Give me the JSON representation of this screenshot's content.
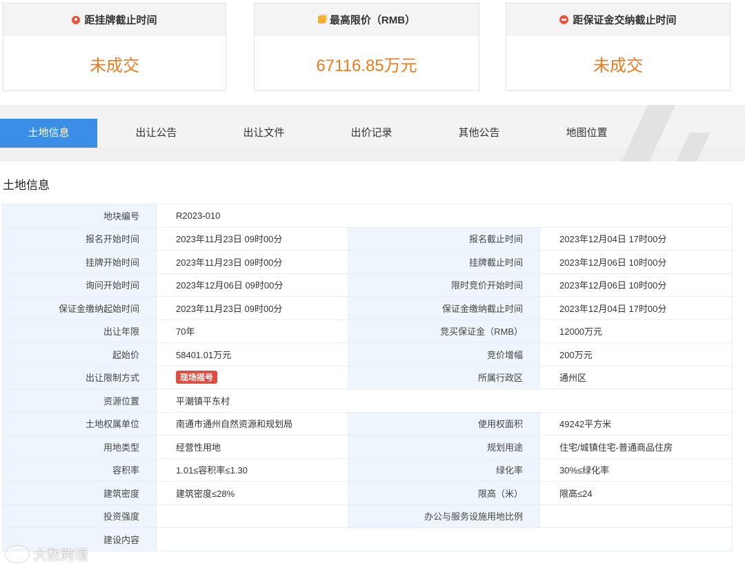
{
  "cards": [
    {
      "title": "距挂牌截止时间",
      "icon": "clock-icon",
      "value": "未成交"
    },
    {
      "title": "最高限价（RMB）",
      "icon": "coin-icon",
      "value": "67116.85万元"
    },
    {
      "title": "距保证金交纳截止时间",
      "icon": "money-bag-icon",
      "value": "未成交"
    }
  ],
  "tabs": [
    "土地信息",
    "出让公告",
    "出让文件",
    "出价记录",
    "其他公告",
    "地图位置"
  ],
  "section_title": "土地信息",
  "fields": {
    "plot_no": {
      "label": "地块编号",
      "value": "R2023-010"
    },
    "reg_start": {
      "label": "报名开始时间",
      "value": "2023年11月23日 09时00分"
    },
    "reg_end": {
      "label": "报名截止时间",
      "value": "2023年12月04日 17时00分"
    },
    "list_start": {
      "label": "挂牌开始时间",
      "value": "2023年11月23日 09时00分"
    },
    "list_end": {
      "label": "挂牌截止时间",
      "value": "2023年12月06日 10时00分"
    },
    "inquiry_start": {
      "label": "询问开始时间",
      "value": "2023年12月06日 09时00分"
    },
    "bid_start": {
      "label": "限时竞价开始时间",
      "value": "2023年12月06日 10时00分"
    },
    "deposit_start": {
      "label": "保证金缴纳起始时间",
      "value": "2023年11月23日 09时00分"
    },
    "deposit_end": {
      "label": "保证金缴纳截止时间",
      "value": "2023年12月04日 17时00分"
    },
    "term": {
      "label": "出让年限",
      "value": "70年"
    },
    "deposit": {
      "label": "竞买保证金（RMB）",
      "value": "12000万元"
    },
    "start_price": {
      "label": "起始价",
      "value": "58401.01万元"
    },
    "increment": {
      "label": "竞价增幅",
      "value": "200万元"
    },
    "limit_method": {
      "label": "出让限制方式",
      "value": "现场摇号"
    },
    "district": {
      "label": "所属行政区",
      "value": "通州区"
    },
    "location": {
      "label": "资源位置",
      "value": "平潮镇平东村"
    },
    "owner": {
      "label": "土地权属单位",
      "value": "南通市通州自然资源和规划局"
    },
    "area": {
      "label": "使用权面积",
      "value": "49242平方米"
    },
    "land_type": {
      "label": "用地类型",
      "value": "经营性用地"
    },
    "planned_use": {
      "label": "规划用途",
      "value": "住宅/城镇住宅-普通商品住房"
    },
    "far": {
      "label": "容积率",
      "value": "1.01≤容积率≤1.30"
    },
    "green": {
      "label": "绿化率",
      "value": "30%≤绿化率"
    },
    "density": {
      "label": "建筑密度",
      "value": "建筑密度≤28%"
    },
    "height": {
      "label": "限高（米）",
      "value": "限高≤24"
    },
    "invest": {
      "label": "投资强度",
      "value": ""
    },
    "office_ratio": {
      "label": "办公与服务设施用地比例",
      "value": ""
    },
    "content": {
      "label": "建设内容",
      "value": ""
    }
  },
  "watermark": "大数跨境"
}
